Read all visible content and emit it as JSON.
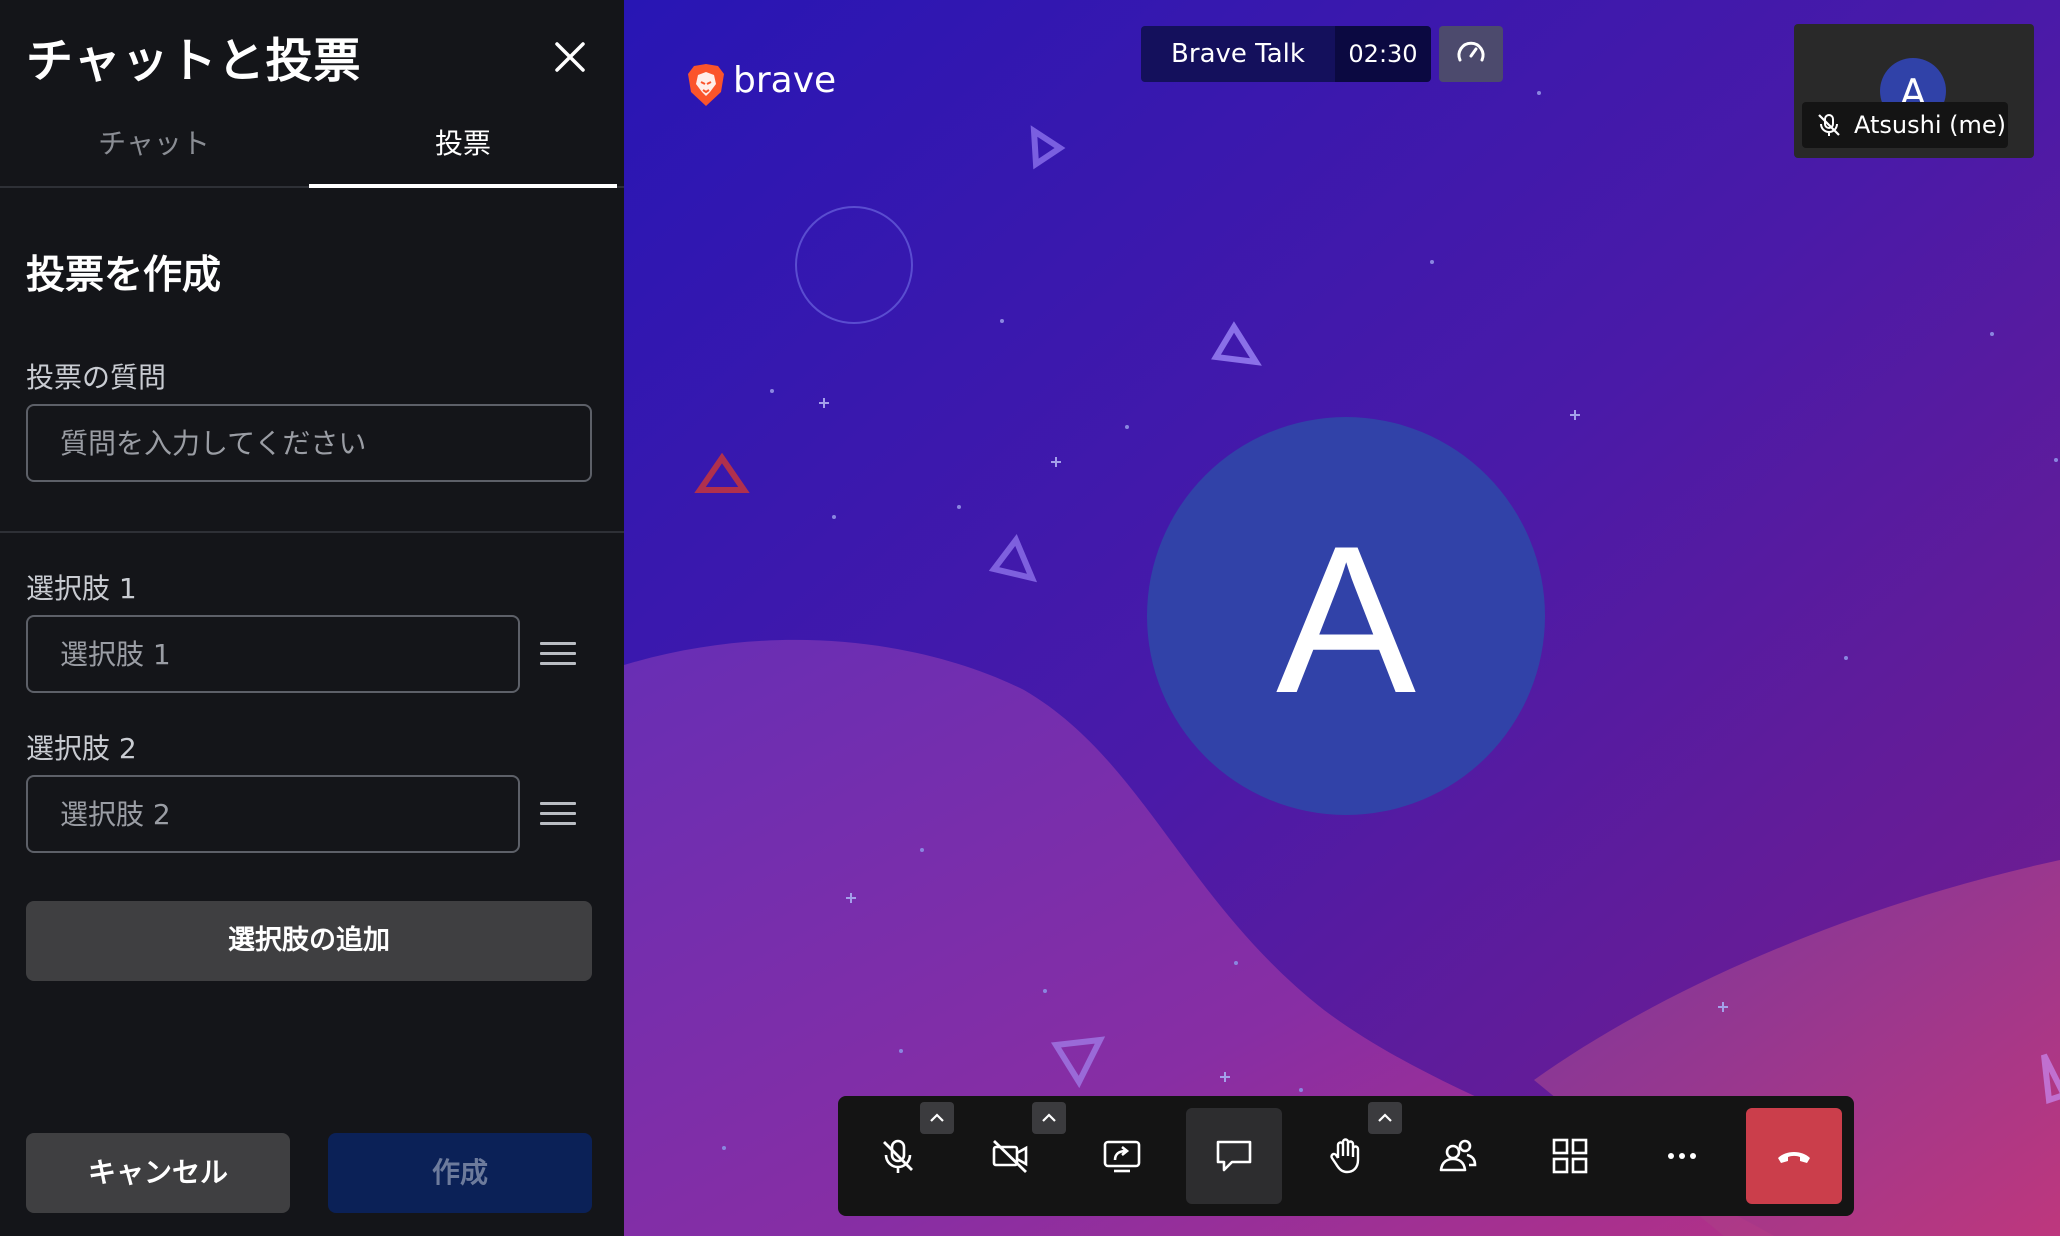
{
  "sidebar": {
    "title": "チャットと投票",
    "tabs": [
      {
        "label": "チャット",
        "active": false
      },
      {
        "label": "投票",
        "active": true
      }
    ],
    "create_heading": "投票を作成",
    "question": {
      "label": "投票の質問",
      "placeholder": "質問を入力してください",
      "value": ""
    },
    "options": [
      {
        "label": "選択肢 1",
        "placeholder": "選択肢 1",
        "value": ""
      },
      {
        "label": "選択肢 2",
        "placeholder": "選択肢 2",
        "value": ""
      }
    ],
    "add_option_label": "選択肢の追加",
    "cancel_label": "キャンセル",
    "create_label": "作成"
  },
  "meeting": {
    "brand": "brave",
    "name": "Brave Talk",
    "timer": "02:30",
    "self_tile": {
      "initial": "A",
      "name": "Atsushi (me)",
      "muted": true
    },
    "main_participant_initial": "A"
  },
  "toolbar": {
    "buttons": [
      {
        "name": "microphone-muted",
        "icon": "mic-off-icon",
        "has_menu": true
      },
      {
        "name": "camera-off",
        "icon": "camera-off-icon",
        "has_menu": true
      },
      {
        "name": "screen-share",
        "icon": "screen-share-icon",
        "has_menu": false
      },
      {
        "name": "chat",
        "icon": "chat-icon",
        "has_menu": false,
        "active": true
      },
      {
        "name": "raise-hand",
        "icon": "hand-icon",
        "has_menu": true
      },
      {
        "name": "participants",
        "icon": "participants-icon",
        "has_menu": false
      },
      {
        "name": "tile-view",
        "icon": "grid-icon",
        "has_menu": false
      },
      {
        "name": "more",
        "icon": "more-icon",
        "has_menu": false
      },
      {
        "name": "leave",
        "icon": "hangup-icon",
        "has_menu": false
      }
    ]
  },
  "colors": {
    "sidebar_bg": "#141519",
    "stage_bg": "#2a17b3",
    "avatar_bg": "#3142a8",
    "hangup": "#cb3e4b",
    "create_btn_bg": "#0b2157"
  }
}
